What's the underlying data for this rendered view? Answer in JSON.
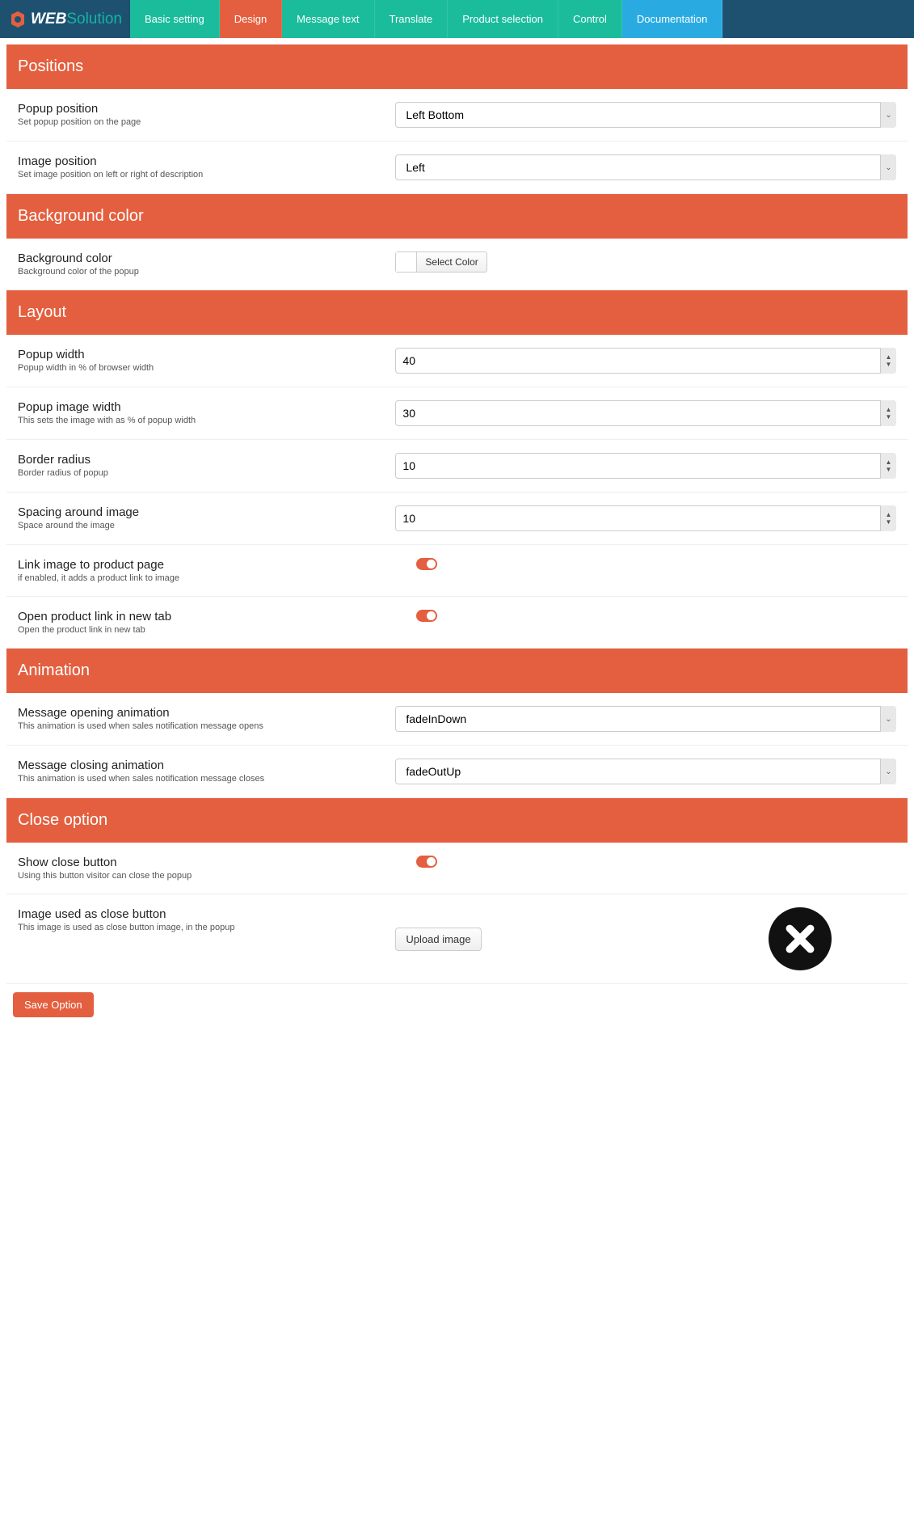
{
  "brand": {
    "text_white": "WEB",
    "text_teal": "Solution"
  },
  "nav": {
    "basic": "Basic setting",
    "design": "Design",
    "message": "Message text",
    "translate": "Translate",
    "product": "Product selection",
    "control": "Control",
    "docs": "Documentation"
  },
  "sections": {
    "positions": "Positions",
    "background": "Background color",
    "layout": "Layout",
    "animation": "Animation",
    "close": "Close option"
  },
  "fields": {
    "popup_position": {
      "title": "Popup position",
      "desc": "Set popup position on the page",
      "value": "Left Bottom"
    },
    "image_position": {
      "title": "Image position",
      "desc": "Set image position on left or right of description",
      "value": "Left"
    },
    "bg_color": {
      "title": "Background color",
      "desc": "Background color of the popup",
      "button": "Select Color"
    },
    "popup_width": {
      "title": "Popup width",
      "desc": "Popup width in % of browser width",
      "value": "40"
    },
    "image_width": {
      "title": "Popup image width",
      "desc": "This sets the image with as % of popup width",
      "value": "30"
    },
    "border_radius": {
      "title": "Border radius",
      "desc": "Border radius of popup",
      "value": "10"
    },
    "spacing": {
      "title": "Spacing around image",
      "desc": "Space around the image",
      "value": "10"
    },
    "link_image": {
      "title": "Link image to product page",
      "desc": "if enabled, it adds a product link to image"
    },
    "new_tab": {
      "title": "Open product link in new tab",
      "desc": "Open the product link in new tab"
    },
    "open_anim": {
      "title": "Message opening animation",
      "desc": "This animation is used when sales notification message opens",
      "value": "fadeInDown"
    },
    "close_anim": {
      "title": "Message closing animation",
      "desc": "This animation is used when sales notification message closes",
      "value": "fadeOutUp"
    },
    "show_close": {
      "title": "Show close button",
      "desc": "Using this button visitor can close the popup"
    },
    "close_image": {
      "title": "Image used as close button",
      "desc": "This image is used as close button image, in the popup",
      "button": "Upload image"
    }
  },
  "save": "Save Option"
}
